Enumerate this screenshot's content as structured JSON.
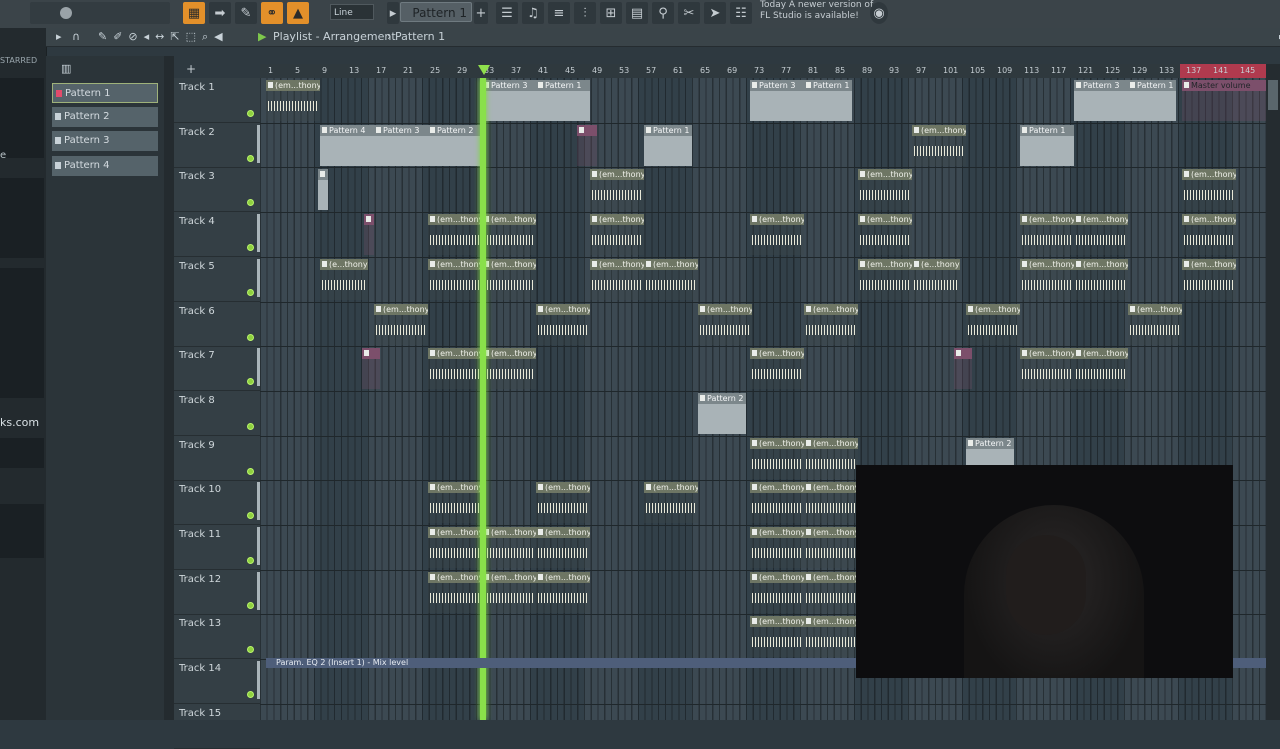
{
  "toolbar": {
    "pattern_label": "Pattern 1",
    "line_mode": "Line",
    "news_line1": "Today  A newer version of",
    "news_line2": "FL Studio is available!"
  },
  "left_panel": {
    "starred_label": "STARRED",
    "url_fragment": "ks.com",
    "e_fragment": "e"
  },
  "window": {
    "title": "Playlist - Arrangement",
    "sep": "›",
    "pattern": "Pattern 1"
  },
  "picker": {
    "items": [
      "Pattern 1",
      "Pattern 2",
      "Pattern 3",
      "Pattern 4"
    ]
  },
  "ruler": {
    "bars": [
      "1",
      "5",
      "9",
      "13",
      "17",
      "21",
      "25",
      "29",
      "33",
      "37",
      "41",
      "45",
      "49",
      "53",
      "57",
      "61",
      "65",
      "69",
      "73",
      "77",
      "81",
      "85",
      "89",
      "93",
      "97",
      "101",
      "105",
      "109",
      "113",
      "117",
      "121",
      "125",
      "129",
      "133",
      "137",
      "141",
      "145"
    ]
  },
  "tracks": [
    "Track 1",
    "Track 2",
    "Track 3",
    "Track 4",
    "Track 5",
    "Track 6",
    "Track 7",
    "Track 8",
    "Track 9",
    "Track 10",
    "Track 11",
    "Track 12",
    "Track 13",
    "Track 14",
    "Track 15"
  ],
  "clip_labels": {
    "audio": "(em...thony",
    "audio_short": "(e...thony",
    "p1": "Pattern 1",
    "p2": "Pattern 2",
    "p3": "Pattern 3",
    "p4": "Pattern 4",
    "master": "Master volume",
    "mix": "Param. EQ 2 (Insert 1) - Mix level"
  }
}
